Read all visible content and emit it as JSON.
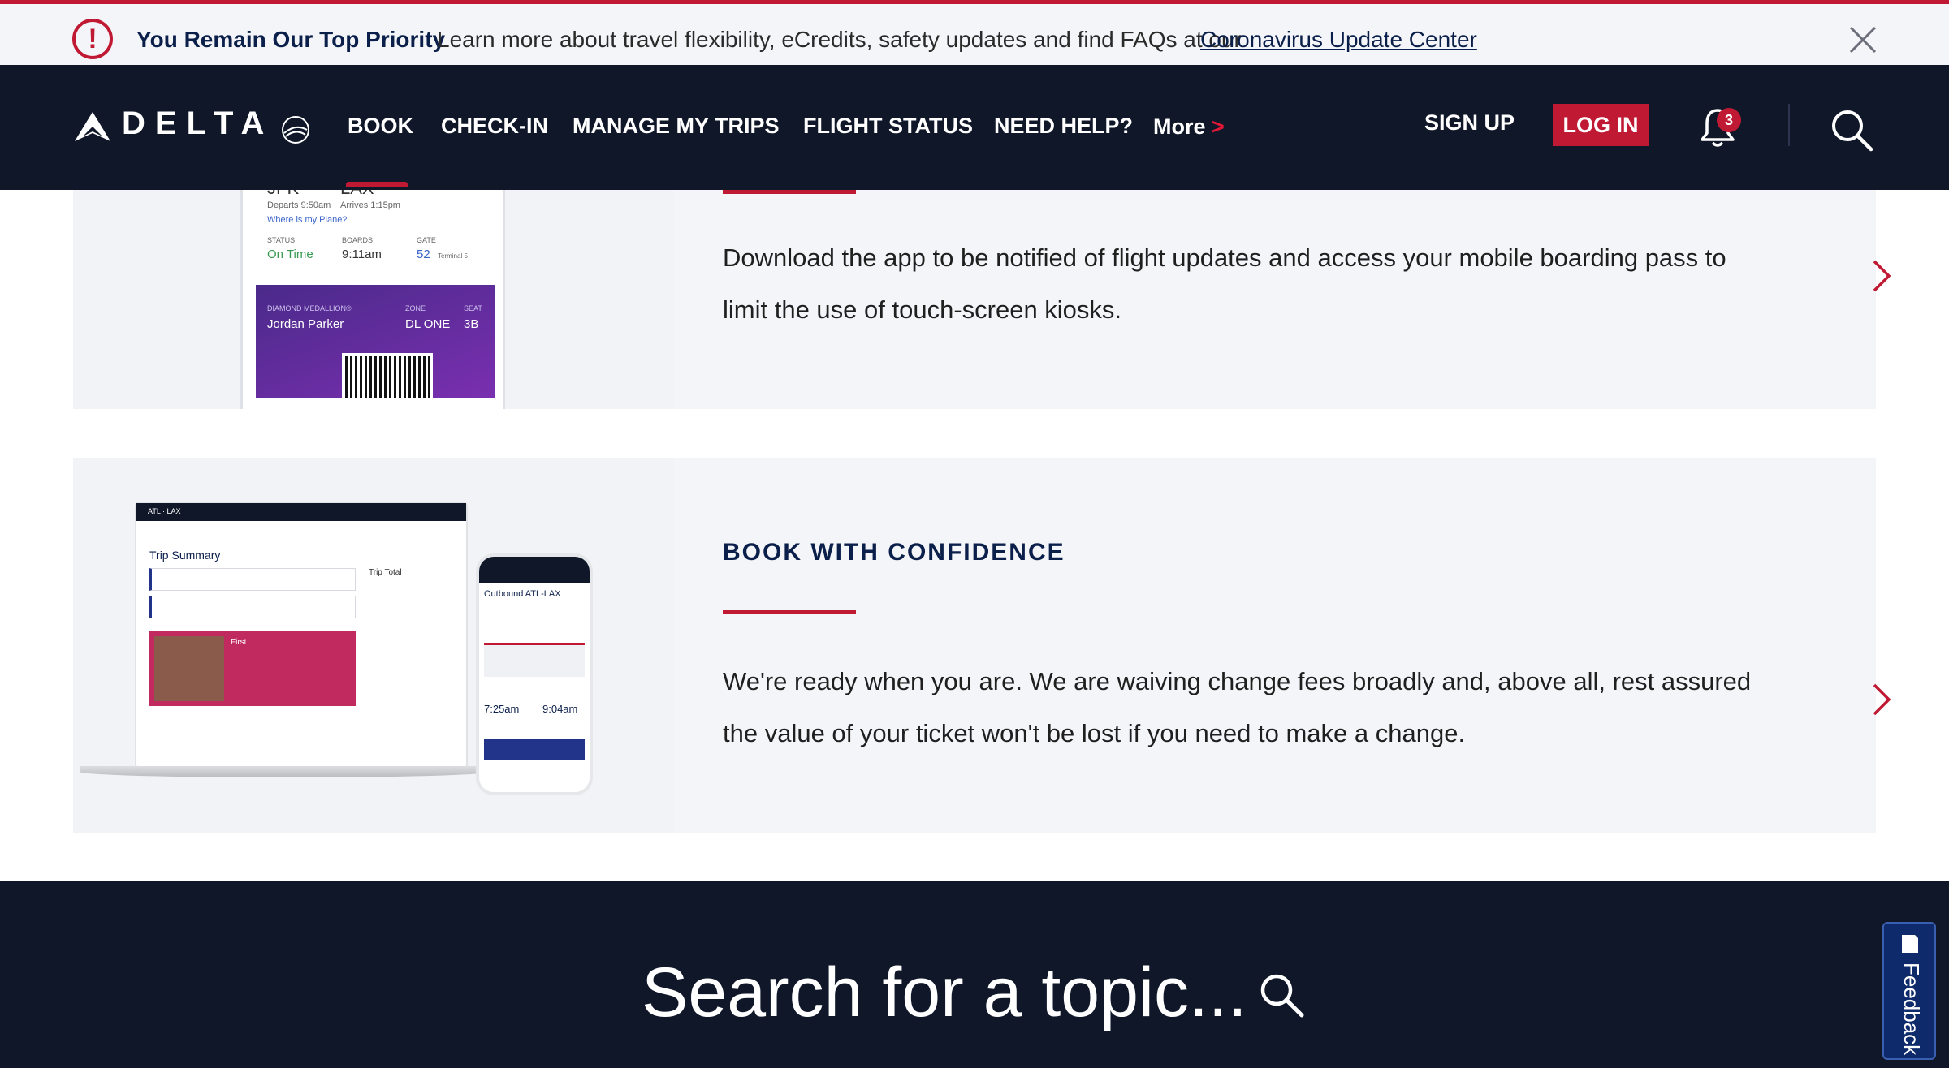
{
  "alert": {
    "title": "You Remain Our Top Priority",
    "text": "Learn more about travel flexibility, eCredits, safety updates and find FAQs at our",
    "link": "Coronavirus Update Center"
  },
  "nav": {
    "logo": "DELTA",
    "items": [
      "BOOK",
      "CHECK-IN",
      "MANAGE MY TRIPS",
      "FLIGHT STATUS",
      "NEED HELP?"
    ],
    "more": "More",
    "signup": "SIGN UP",
    "login": "LOG IN",
    "notification_count": "3"
  },
  "cards": [
    {
      "description": "Download the app to be notified of flight updates and access your mobile boarding pass to limit the use of touch-screen kiosks.",
      "mock": {
        "from": "JFK",
        "to": "LAX",
        "departs": "Departs 9:50am",
        "arrives": "Arrives 1:15pm",
        "where_plane": "Where is my Plane?",
        "status_label": "STATUS",
        "status_value": "On Time",
        "boards_label": "BOARDS",
        "boards_value": "9:11am",
        "gate_label": "GATE",
        "gate_value": "52",
        "terminal": "Terminal 5",
        "medallion": "DIAMOND MEDALLION®",
        "passenger": "Jordan Parker",
        "zone_label": "ZONE",
        "zone_value": "DL ONE",
        "seat_label": "SEAT",
        "seat_value": "3B"
      }
    },
    {
      "title": "BOOK WITH CONFIDENCE",
      "description": "We're ready when you are. We are waiving change fees broadly and, above all, rest assured the value of your ticket won't be lost if you need to make a change.",
      "mock": {
        "route": "ATL · LAX",
        "trip_summary": "Trip Summary",
        "trip_total": "Trip Total",
        "promo": "First",
        "outbound": "Outbound ATL-LAX",
        "depart_time": "7:25am",
        "arrive_time": "9:04am"
      }
    }
  ],
  "footer": {
    "search_text": "Search for a topic..."
  },
  "feedback": {
    "label": "Feedback"
  },
  "colors": {
    "navy": "#0f1729",
    "brand_red": "#c01933",
    "card_bg": "#f4f5f8"
  }
}
